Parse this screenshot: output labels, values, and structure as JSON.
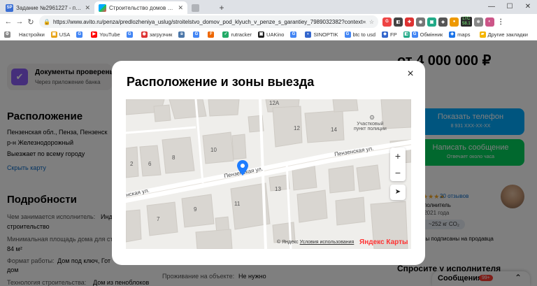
{
  "browser": {
    "tabs": [
      {
        "favicon": "SP",
        "title": "Задание №2961227 - просмотр з..."
      },
      {
        "favicon": "avito",
        "title": "Строительство домов под ключ с..."
      },
      {
        "favicon": "page",
        "title": ""
      }
    ],
    "url": "https://www.avito.ru/penza/predlozheniya_uslug/stroitelstvo_domov_pod_klyuch_v_penze_s_garantiey_7989032382?context=...",
    "ext_ltc": "LTC",
    "ext_ltc_value": "58.1",
    "bookmarks": [
      "Настройки",
      "USA",
      "YouTube",
      "загрузчик",
      "rutracker",
      "UAKino",
      "SINOPTIK",
      "btc to usd",
      "FP",
      "Обмінник",
      "maps"
    ],
    "bookmarks_other": "Другие закладки"
  },
  "page": {
    "price": "от 4 000 000 ₽",
    "verified_title": "Документы проверены",
    "verified_sub": "Через приложение банка",
    "location_heading": "Расположение",
    "address_line1": "Пензенская обл., Пенза, Пензенск",
    "address_line2": "р-н Железнодорожный",
    "travel": "Выезжает по всему городу",
    "hide_map": "Скрыть карту",
    "details_heading": "Подробности",
    "details": [
      {
        "label": "Чем занимается исполнитель:",
        "value": "Инд"
      },
      {
        "label": "",
        "value": "строительство"
      },
      {
        "label": "Минимальная площадь дома для ст",
        "value": ""
      },
      {
        "label": "",
        "value": "84 м²"
      },
      {
        "label": "Формат работы:",
        "value": "Дом под ключ, Гот"
      },
      {
        "label": "",
        "value": "дом"
      },
      {
        "label": "Технология строительства:",
        "value": "Дом из пеноблоков"
      }
    ],
    "onsite_label": "Проживание на объекте:",
    "onsite_value": "Не нужно",
    "phone_button": "Показать телефон",
    "phone_masked": "8 931 XXX-XX-XX",
    "message_button": "Написать сообщение",
    "message_sub": "Отвечает около часа",
    "reviews": "20 отзывов",
    "rating_stars": 5,
    "executor_label": "сполнитель",
    "since": "с 2021 года",
    "co2": "~252 кг CO₂",
    "subscribed": "5ы подписаны на продавца",
    "ask_heading": "Спросите у исполнителя",
    "messages_label": "Сообщения",
    "messages_badge": "99+"
  },
  "modal": {
    "title": "Расположение и зоны выезда",
    "close_label": "×",
    "zoom_in": "+",
    "zoom_out": "−",
    "house_numbers": [
      "12А",
      "12",
      "14",
      "10",
      "8",
      "2",
      "6",
      "13",
      "11",
      "9",
      "7"
    ],
    "street_1": "Пензенская ул.",
    "street_2": "Пензенская ул.",
    "street_3": "нская ул.",
    "poi_line1": "Участковый",
    "poi_line2": "пункт полиции",
    "attribution_prefix": "© Яндекс",
    "attribution_link": "Условия использования",
    "brand": "Яндекс Карты"
  }
}
